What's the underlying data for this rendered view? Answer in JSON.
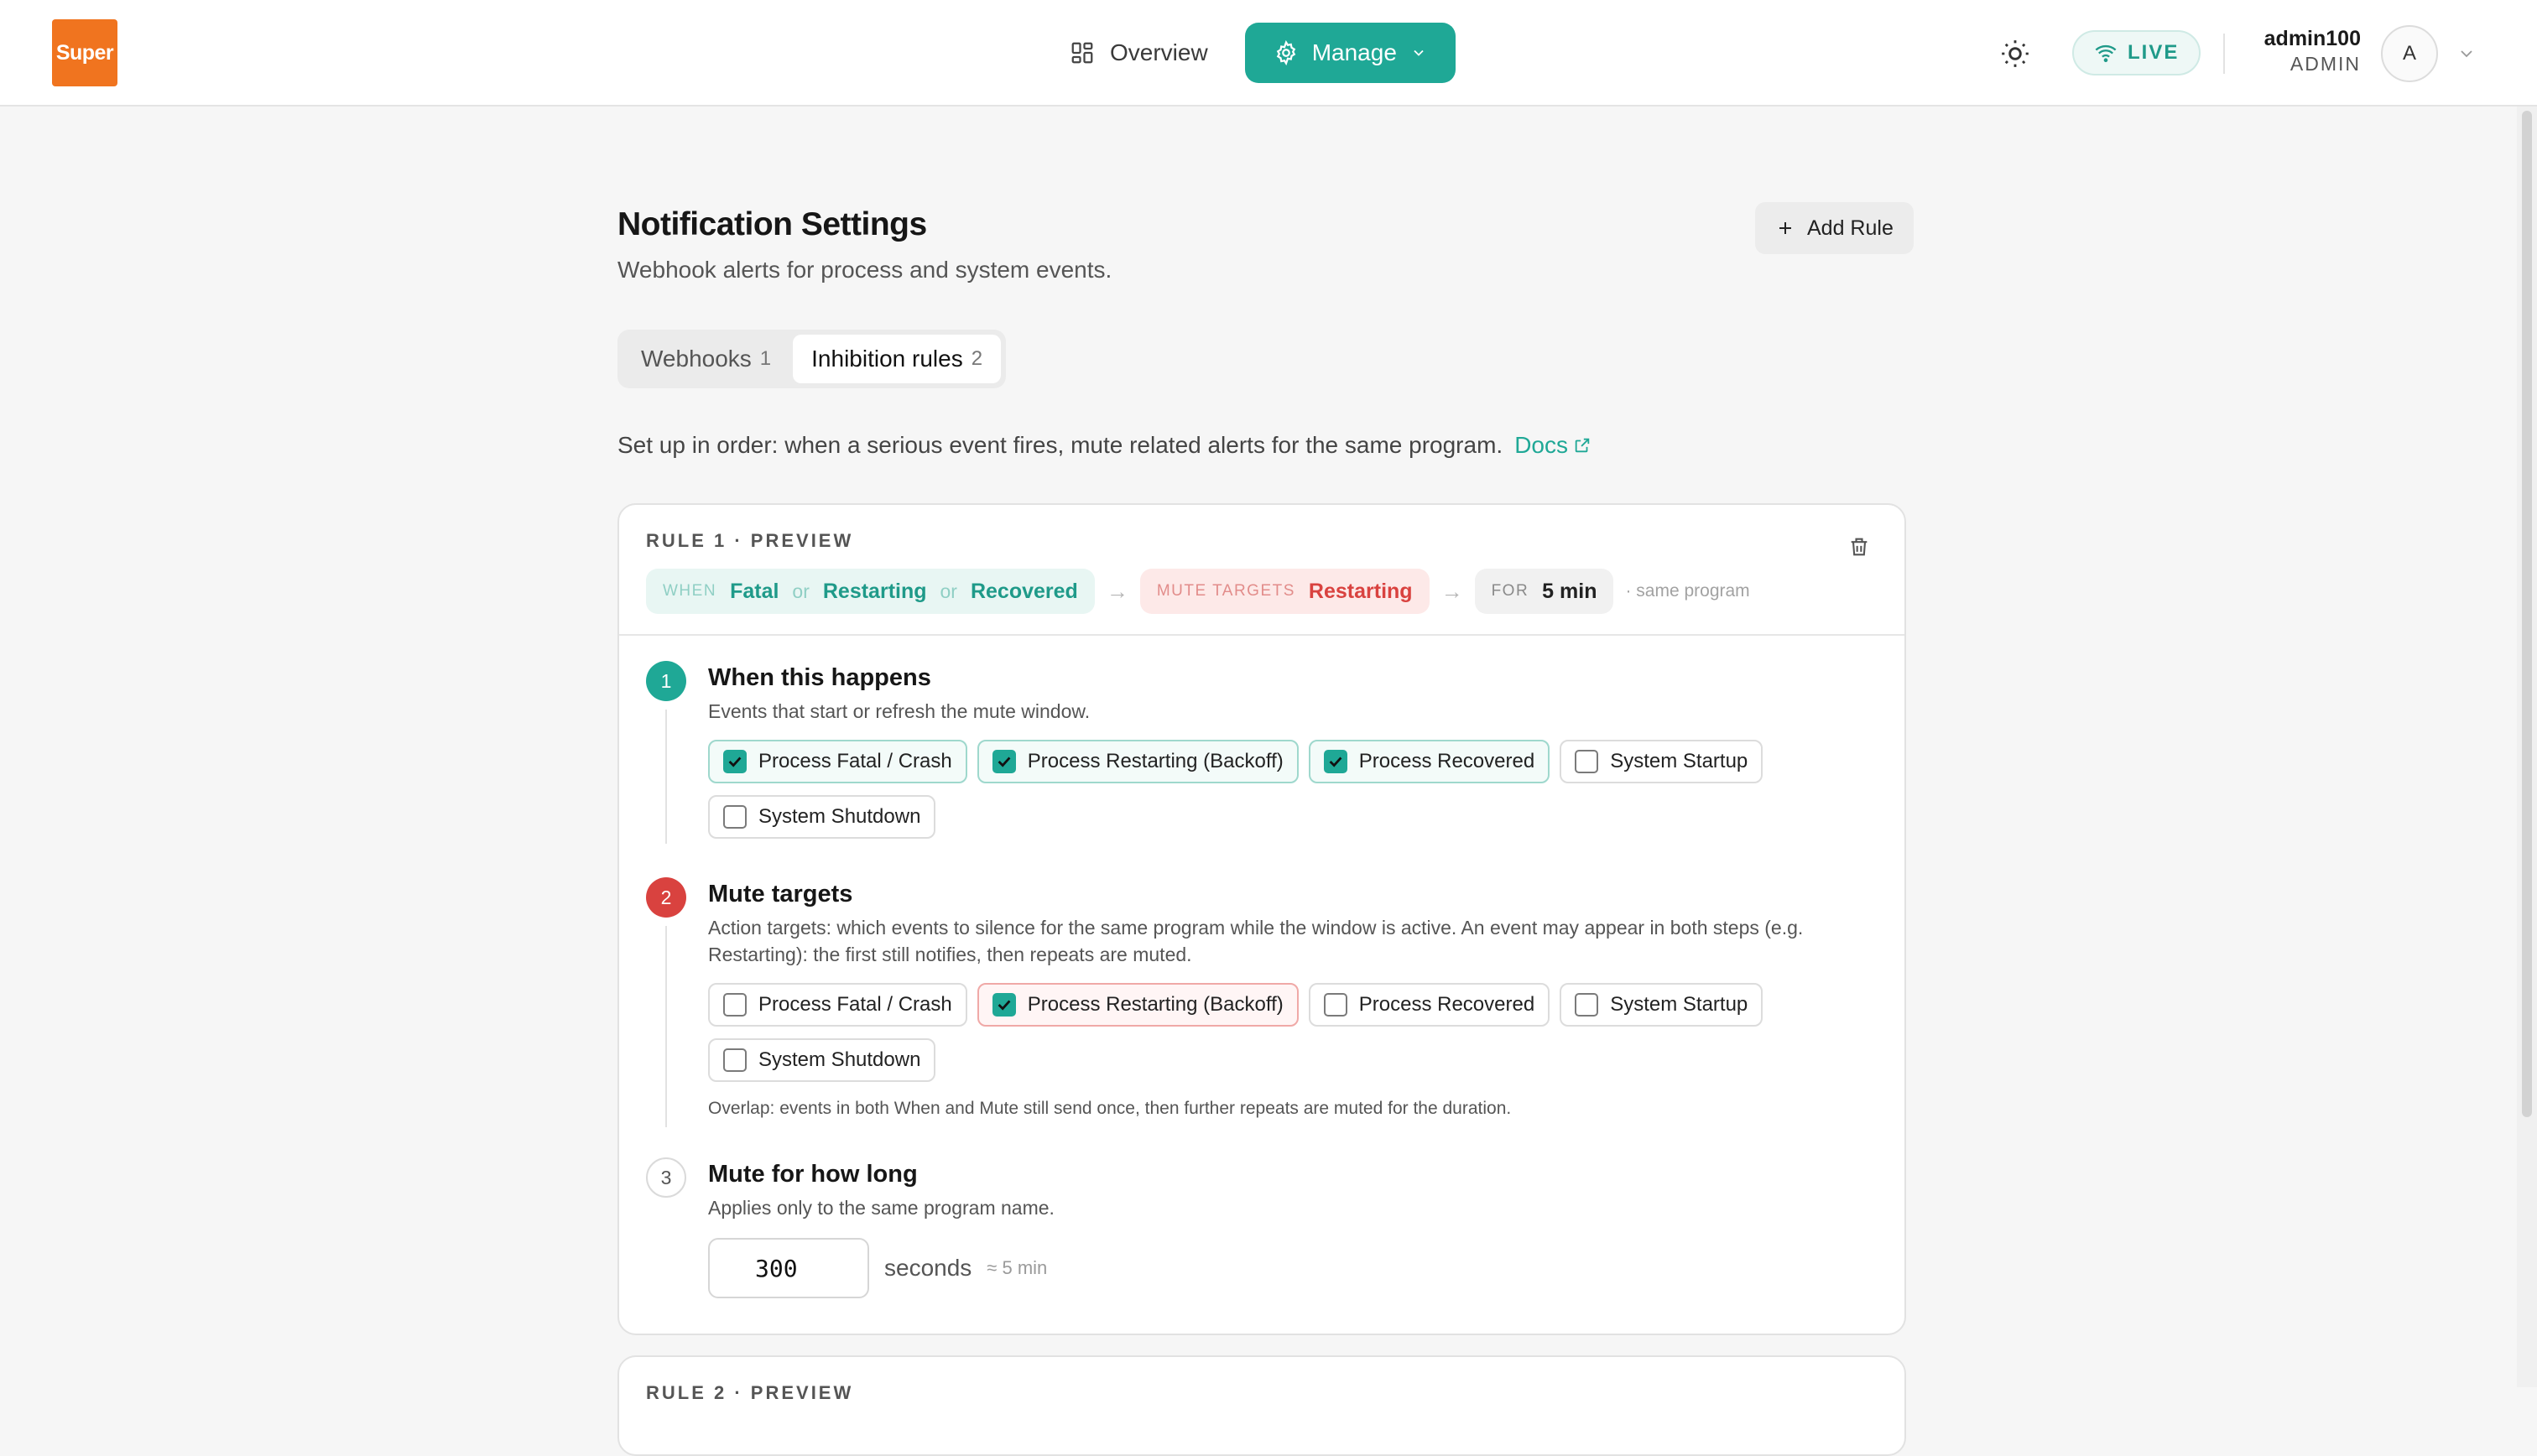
{
  "header": {
    "logo_text": "Super",
    "nav": {
      "overview": "Overview",
      "manage": "Manage"
    },
    "live_label": "LIVE",
    "user": {
      "name": "admin100",
      "role": "ADMIN",
      "avatar_initial": "A"
    }
  },
  "page": {
    "title": "Notification Settings",
    "subtitle": "Webhook alerts for process and system events.",
    "add_rule": "Add Rule"
  },
  "tabs": [
    {
      "label": "Webhooks",
      "count": "1",
      "active": false
    },
    {
      "label": "Inhibition rules",
      "count": "2",
      "active": true
    }
  ],
  "intro": {
    "text": "Set up in order: when a serious event fires, mute related alerts for the same program.",
    "docs": "Docs"
  },
  "rule1": {
    "label": "RULE 1 · PREVIEW",
    "preview": {
      "when_tag": "WHEN",
      "when_values": [
        "Fatal",
        "Restarting",
        "Recovered"
      ],
      "or_word": "or",
      "mute_tag": "MUTE TARGETS",
      "mute_value": "Restarting",
      "for_tag": "FOR",
      "for_value": "5 min",
      "scope": "· same program"
    },
    "steps": {
      "when": {
        "num": "1",
        "title": "When this happens",
        "desc": "Events that start or refresh the mute window.",
        "options": [
          {
            "label": "Process Fatal / Crash",
            "checked": true
          },
          {
            "label": "Process Restarting (Backoff)",
            "checked": true
          },
          {
            "label": "Process Recovered",
            "checked": true
          },
          {
            "label": "System Startup",
            "checked": false
          },
          {
            "label": "System Shutdown",
            "checked": false
          }
        ]
      },
      "mute": {
        "num": "2",
        "title": "Mute targets",
        "desc": "Action targets: which events to silence for the same program while the window is active. An event may appear in both steps (e.g. Restarting): the first still notifies, then repeats are muted.",
        "options": [
          {
            "label": "Process Fatal / Crash",
            "checked": false
          },
          {
            "label": "Process Restarting (Backoff)",
            "checked": true
          },
          {
            "label": "Process Recovered",
            "checked": false
          },
          {
            "label": "System Startup",
            "checked": false
          },
          {
            "label": "System Shutdown",
            "checked": false
          }
        ],
        "note": "Overlap: events in both When and Mute still send once, then further repeats are muted for the duration."
      },
      "duration": {
        "num": "3",
        "title": "Mute for how long",
        "desc": "Applies only to the same program name.",
        "value": "300",
        "unit": "seconds",
        "approx": "≈ 5 min"
      }
    }
  },
  "rule2": {
    "label": "RULE 2 · PREVIEW"
  },
  "colors": {
    "accent": "#1fa896",
    "danger": "#d9423f",
    "brand": "#f0741f"
  }
}
